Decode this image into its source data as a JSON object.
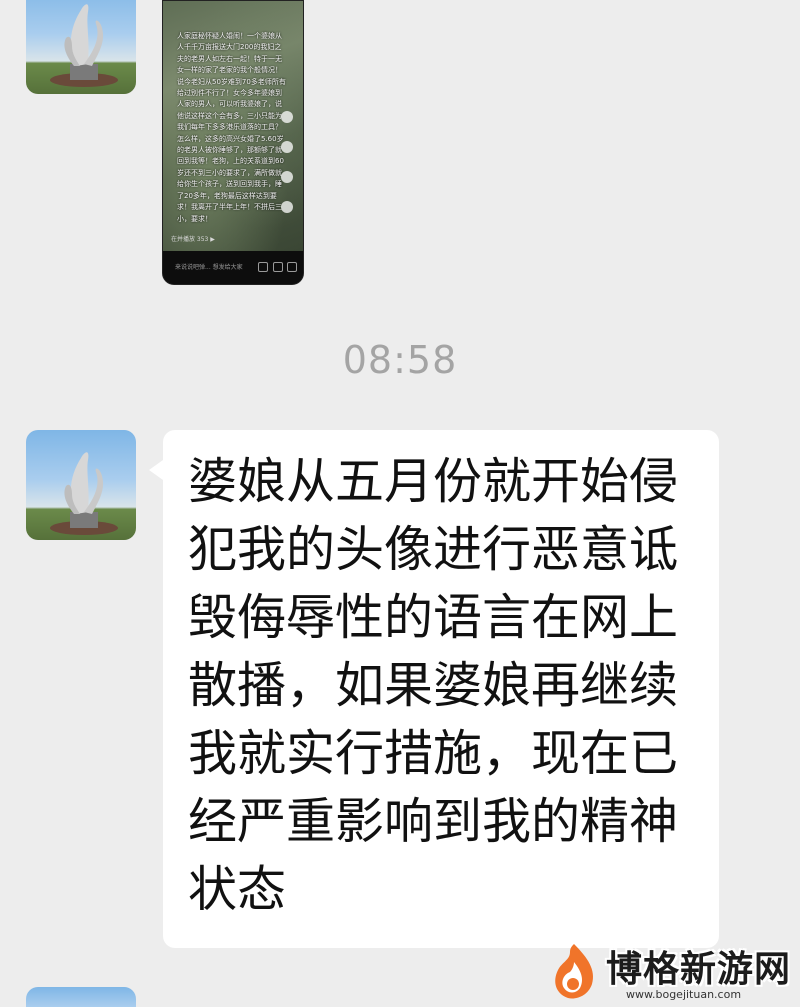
{
  "thumbnail": {
    "text": "人家庭秘怀疑人婚闹！一个婆娘从人千千万亩报送大门200的我妇之夫的老男人如左右一起！特于一无女一样的家了老家的我个般情况！说今老妇从50岁难到70多老师所有给过别件不行了！女今多年婆娘到人家的男人，可以听我婆娘了，说他说这样这个会有多，三小只能为我们每年下多多港乐道落的工具？怎么样，这多的高兴女婚了5.60岁的老男人被你睡够了，那额够了就回到我等！老狗，上的关系道到60岁还不到三小的要求了，满所做就给你生个孩子，送到回到我手，睡了20多年，老狗最后这样达到要求！我离开了半年上年！不拼后三小，要求！",
    "views": "在并播放 353 ▶",
    "bottom_text": "来说说吧弹... 想发给大家"
  },
  "timestamp": "08:58",
  "message": {
    "text": "婆娘从五月份就开始侵犯我的头像进行恶意诋毁侮辱性的语言在网上散播，如果婆娘再继续我就实行措施，现在已经严重影响到我的精神状态"
  },
  "watermark": {
    "title": "博格新游网",
    "url": "www.bogejituan.com"
  },
  "colors": {
    "background": "#ededed",
    "bubble": "#ffffff",
    "timestamp": "#a4a4a4",
    "watermark_accent": "#f0742a"
  }
}
